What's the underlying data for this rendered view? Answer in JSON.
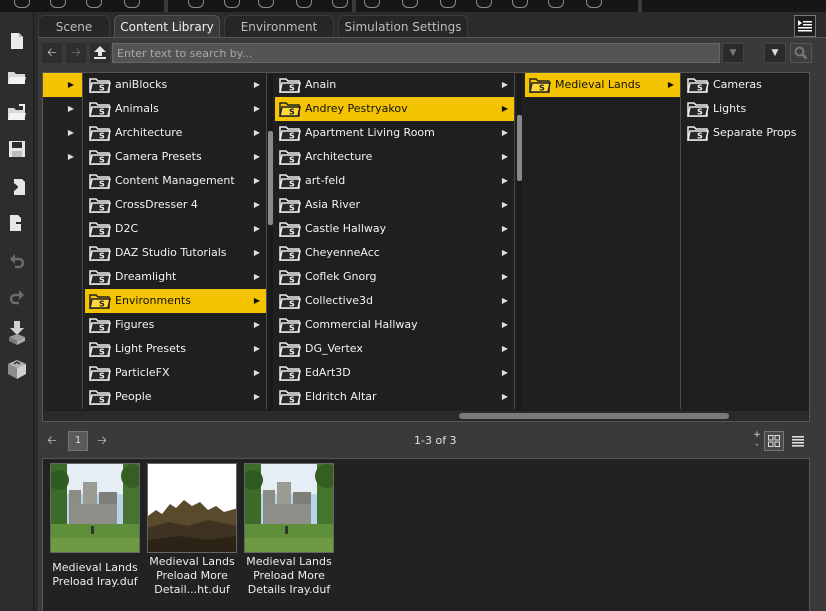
{
  "tabs": [
    {
      "label": "Scene"
    },
    {
      "label": "Content Library"
    },
    {
      "label": "Environment"
    },
    {
      "label": "Simulation Settings"
    }
  ],
  "search": {
    "placeholder": "Enter text to search by..."
  },
  "browser": {
    "column0_rows": 4,
    "column1": [
      {
        "label": "aniBlocks"
      },
      {
        "label": "Animals"
      },
      {
        "label": "Architecture"
      },
      {
        "label": "Camera Presets"
      },
      {
        "label": "Content Management"
      },
      {
        "label": "CrossDresser 4"
      },
      {
        "label": "D2C"
      },
      {
        "label": "DAZ Studio Tutorials"
      },
      {
        "label": "Dreamlight"
      },
      {
        "label": "Environments"
      },
      {
        "label": "Figures"
      },
      {
        "label": "Light Presets"
      },
      {
        "label": "ParticleFX"
      },
      {
        "label": "People"
      }
    ],
    "column2": [
      {
        "label": "Anain"
      },
      {
        "label": "Andrey Pestryakov"
      },
      {
        "label": "Apartment Living Room"
      },
      {
        "label": "Architecture"
      },
      {
        "label": "art-feld"
      },
      {
        "label": "Asia River"
      },
      {
        "label": "Castle Hallway"
      },
      {
        "label": "CheyenneAcc"
      },
      {
        "label": "Coflek Gnorg"
      },
      {
        "label": "Collective3d"
      },
      {
        "label": "Commercial Hallway"
      },
      {
        "label": "DG_Vertex"
      },
      {
        "label": "EdArt3D"
      },
      {
        "label": "Eldritch Altar"
      }
    ],
    "column3": [
      {
        "label": "Medieval Lands"
      }
    ],
    "column4": [
      {
        "label": "Cameras"
      },
      {
        "label": "Lights"
      },
      {
        "label": "Separate Props"
      }
    ],
    "selected": {
      "column1": "Environments",
      "column2": "Andrey Pestryakov",
      "column3": "Medieval Lands"
    }
  },
  "pager": {
    "page": "1",
    "result_count": "1-3 of 3",
    "zoom_plus": "+",
    "zoom_minus": "-"
  },
  "results": [
    {
      "line1": "Medieval Lands",
      "line2": "Preload Iray.duf",
      "line3": "",
      "thumb": "castle-green"
    },
    {
      "line1": "Medieval Lands",
      "line2": "Preload More",
      "line3": "Detail...ht.duf",
      "thumb": "ruins-white"
    },
    {
      "line1": "Medieval Lands",
      "line2": "Preload More",
      "line3": "Details Iray.duf",
      "thumb": "castle-green"
    }
  ],
  "colors": {
    "selection": "#f5c400",
    "panel": "#3a3a3a",
    "browser_bg": "#1f1f1f"
  }
}
